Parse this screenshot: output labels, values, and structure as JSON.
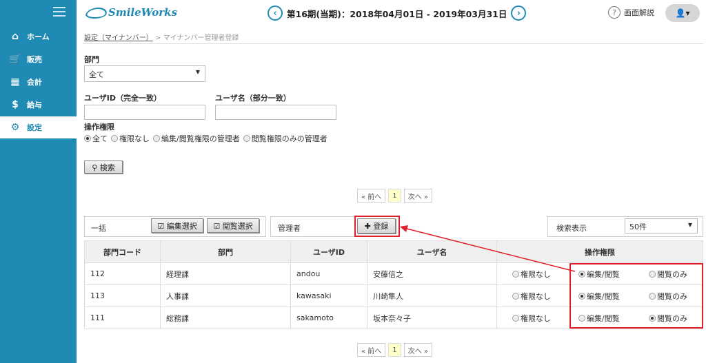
{
  "sidebar": {
    "items": [
      {
        "label": "ホーム",
        "icon": "home-icon",
        "glyph": "⌂"
      },
      {
        "label": "販売",
        "icon": "cart-icon",
        "glyph": "🛒"
      },
      {
        "label": "会計",
        "icon": "calculator-icon",
        "glyph": "▦"
      },
      {
        "label": "給与",
        "icon": "money-bag-icon",
        "glyph": "$"
      },
      {
        "label": "設定",
        "icon": "gear-icon",
        "glyph": "⚙"
      }
    ],
    "active_index": 4
  },
  "header": {
    "logo": "SmileWorks",
    "period": "第16期(当期)：2018年04月01日 - 2019年03月31日",
    "prev_glyph": "‹",
    "next_glyph": "›",
    "help_label": "画面解説",
    "user_glyph": "👤▾"
  },
  "breadcrumb": {
    "parent": "設定（マイナンバー）",
    "separator": ">",
    "current": "マイナンバー管理者登録"
  },
  "search": {
    "dept_label": "部門",
    "dept_value": "全て",
    "userid_label": "ユーザID（完全一致）",
    "userid_value": "",
    "username_label": "ユーザ名（部分一致）",
    "username_value": "",
    "perm_label": "操作権限",
    "perm_options": [
      "全て",
      "権限なし",
      "編集/閲覧権限の管理者",
      "閲覧権限のみの管理者"
    ],
    "perm_selected": 0,
    "search_button": "⚲ 検索"
  },
  "pager": {
    "prev": "« 前へ",
    "current": "1",
    "next": "次へ »"
  },
  "bulk": {
    "label": "一括",
    "edit_select": "☑ 編集選択",
    "view_select": "☑ 閲覧選択",
    "admin_label": "管理者",
    "register_button": "✚ 登録",
    "display_label": "検索表示",
    "display_value": "50件"
  },
  "table": {
    "headers": [
      "部門コード",
      "部門",
      "ユーザID",
      "ユーザ名",
      "操作権限"
    ],
    "perm_options": [
      "権限なし",
      "編集/閲覧",
      "閲覧のみ"
    ],
    "rows": [
      {
        "code": "112",
        "dept": "経理課",
        "userid": "andou",
        "name": "安藤信之",
        "perm": 1
      },
      {
        "code": "113",
        "dept": "人事課",
        "userid": "kawasaki",
        "name": "川崎隼人",
        "perm": 1
      },
      {
        "code": "111",
        "dept": "総務課",
        "userid": "sakamoto",
        "name": "坂本奈々子",
        "perm": 2
      }
    ]
  },
  "colors": {
    "sidebar": "#1f8ab4",
    "annotation": "#e0202a"
  }
}
